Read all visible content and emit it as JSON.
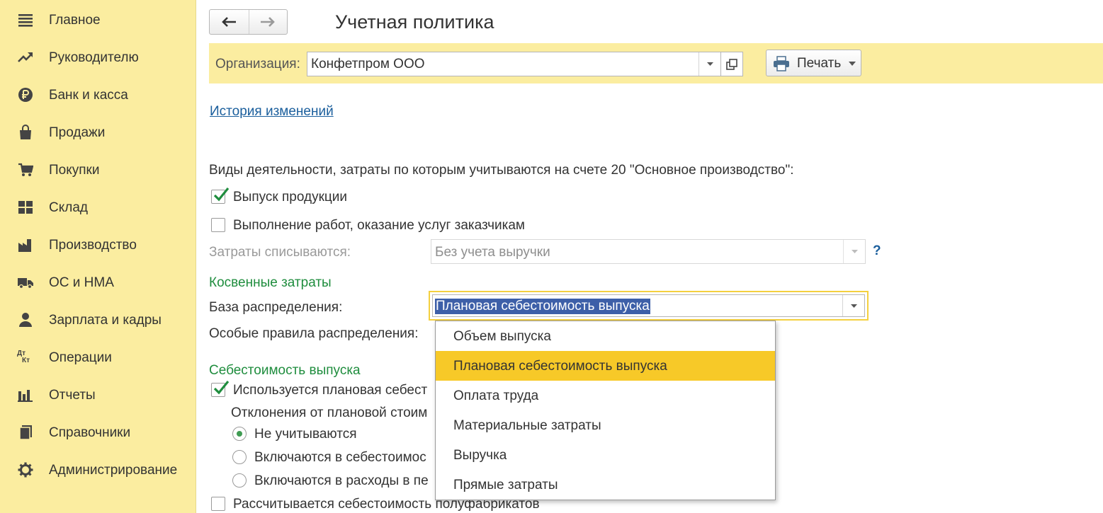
{
  "sidebar": {
    "items": [
      {
        "label": "Главное",
        "icon": "menu-icon"
      },
      {
        "label": "Руководителю",
        "icon": "trend-icon"
      },
      {
        "label": "Банк и касса",
        "icon": "ruble-icon"
      },
      {
        "label": "Продажи",
        "icon": "shopping-bag-icon"
      },
      {
        "label": "Покупки",
        "icon": "cart-icon"
      },
      {
        "label": "Склад",
        "icon": "warehouse-icon"
      },
      {
        "label": "Производство",
        "icon": "factory-icon"
      },
      {
        "label": "ОС и НМА",
        "icon": "truck-icon"
      },
      {
        "label": "Зарплата и кадры",
        "icon": "person-icon"
      },
      {
        "label": "Операции",
        "icon": "debit-credit-icon"
      },
      {
        "label": "Отчеты",
        "icon": "bar-chart-icon"
      },
      {
        "label": "Справочники",
        "icon": "books-icon"
      },
      {
        "label": "Администрирование",
        "icon": "gear-icon"
      }
    ],
    "debit_credit_top": "Дт",
    "debit_credit_bottom": "Кт"
  },
  "header": {
    "title": "Учетная политика",
    "back_icon": "arrow-left-icon",
    "forward_icon": "arrow-right-icon"
  },
  "org_bar": {
    "label": "Организация:",
    "value": "Конфетпром ООО",
    "print_label": "Печать"
  },
  "history_link": "История изменений",
  "activities": {
    "heading": "Виды деятельности, затраты по которым учитываются на счете 20 \"Основное производство\":",
    "output_label": "Выпуск продукции",
    "output_checked": true,
    "services_label": "Выполнение работ, оказание услуг заказчикам",
    "services_checked": false,
    "writeoff_label": "Затраты списываются:",
    "writeoff_value": "Без учета выручки",
    "help": "?"
  },
  "indirect": {
    "section_title": "Косвенные затраты",
    "base_label": "База распределения:",
    "base_value": "Плановая себестоимость выпуска",
    "special_rules_label": "Особые правила распределения:"
  },
  "cost": {
    "section_title": "Себестоимость выпуска",
    "planned_label": "Используется плановая себест",
    "planned_checked": true,
    "deviations_label": "Отклонения от плановой стоим",
    "radio_options": [
      {
        "label": "Не учитываются",
        "selected": true
      },
      {
        "label": "Включаются в себестоимос",
        "selected": false
      },
      {
        "label": "Включаются в расходы в пе",
        "selected": false
      }
    ],
    "semi_label": "Рассчитывается себестоимость полуфабрикатов",
    "semi_checked": false
  },
  "dropdown": {
    "options": [
      "Объем выпуска",
      "Плановая себестоимость выпуска",
      "Оплата труда",
      "Материальные затраты",
      "Выручка",
      "Прямые затраты"
    ],
    "highlighted": "Плановая себестоимость выпуска"
  },
  "colors": {
    "sidebar_bg": "#fbeda0",
    "section_green": "#1f8d3e",
    "link_blue": "#1a5e9c",
    "highlight_yellow": "#f7c928",
    "selection_blue": "#3d5fa8"
  }
}
